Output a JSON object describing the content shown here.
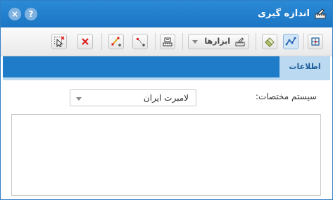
{
  "window": {
    "title": "اندازه گیری",
    "icon": "measure-ruler-icon"
  },
  "titlebar_buttons": {
    "help_label": "?",
    "close_label": "×"
  },
  "toolbar": {
    "tools_dropdown_label": "ابزارها",
    "buttons": [
      "measure-area-icon",
      "measure-distance-icon",
      "eraser-icon",
      "tools-icon",
      "measure-units-icon",
      "add-point-icon",
      "add-line-icon",
      "clear-icon",
      "clear-selection-icon"
    ]
  },
  "tabs": [
    {
      "label": "اطلاعات",
      "active": true
    }
  ],
  "form": {
    "coordinate_system_label": "سیستم مختصات:",
    "coordinate_system_value": "لامبرت ایران"
  },
  "colors": {
    "titlebar": "#1b75c4",
    "tabstrip": "#1e7cc8",
    "active_tab": "#bcd9f2"
  }
}
